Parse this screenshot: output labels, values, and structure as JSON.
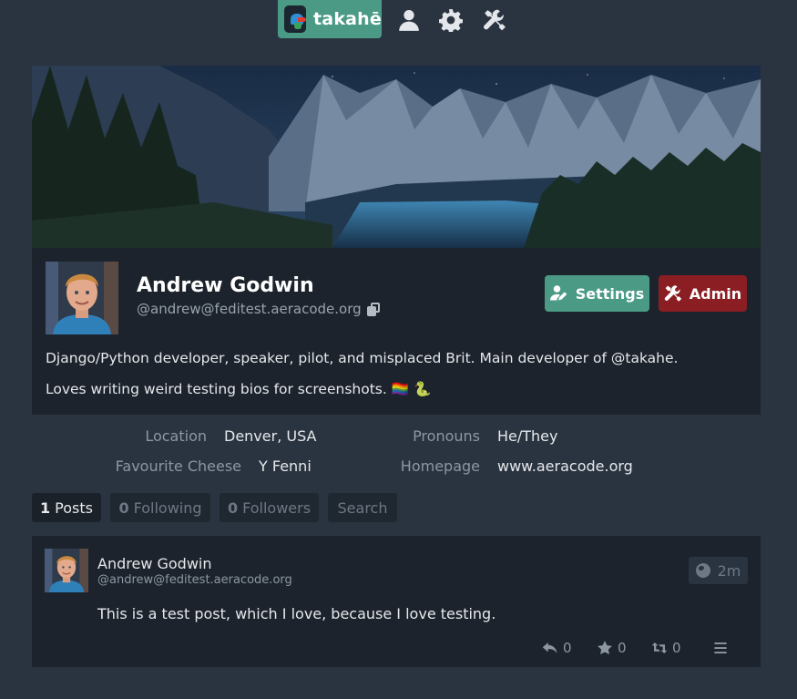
{
  "nav": {
    "brand": "takahē",
    "icons": [
      "user-icon",
      "gear-icon",
      "tools-icon"
    ]
  },
  "profile": {
    "name": "Andrew Godwin",
    "handle": "@andrew@feditest.aeracode.org",
    "settings_label": "Settings",
    "admin_label": "Admin",
    "bio": [
      "Django/Python developer, speaker, pilot, and misplaced Brit. Main developer of @takahe.",
      "Loves writing weird testing bios for screenshots. 🏳️‍🌈 🐍"
    ]
  },
  "metadata": [
    {
      "label": "Location",
      "value": "Denver, USA"
    },
    {
      "label": "Pronouns",
      "value": "He/They"
    },
    {
      "label": "Favourite Cheese",
      "value": "Y Fenni"
    },
    {
      "label": "Homepage",
      "value": "www.aeracode.org"
    }
  ],
  "tabs": [
    {
      "count": "1",
      "label": "Posts",
      "active": true
    },
    {
      "count": "0",
      "label": "Following",
      "active": false
    },
    {
      "count": "0",
      "label": "Followers",
      "active": false
    },
    {
      "count": "",
      "label": "Search",
      "active": false
    }
  ],
  "post": {
    "author": "Andrew Godwin",
    "handle": "@andrew@feditest.aeracode.org",
    "time": "2m",
    "content": "This is a test post, which I love, because I love testing.",
    "replies": "0",
    "likes": "0",
    "boosts": "0"
  },
  "colors": {
    "accent": "#4b9a86",
    "admin": "#8b1e22",
    "background": "#2a3440",
    "card": "#1c232c"
  }
}
